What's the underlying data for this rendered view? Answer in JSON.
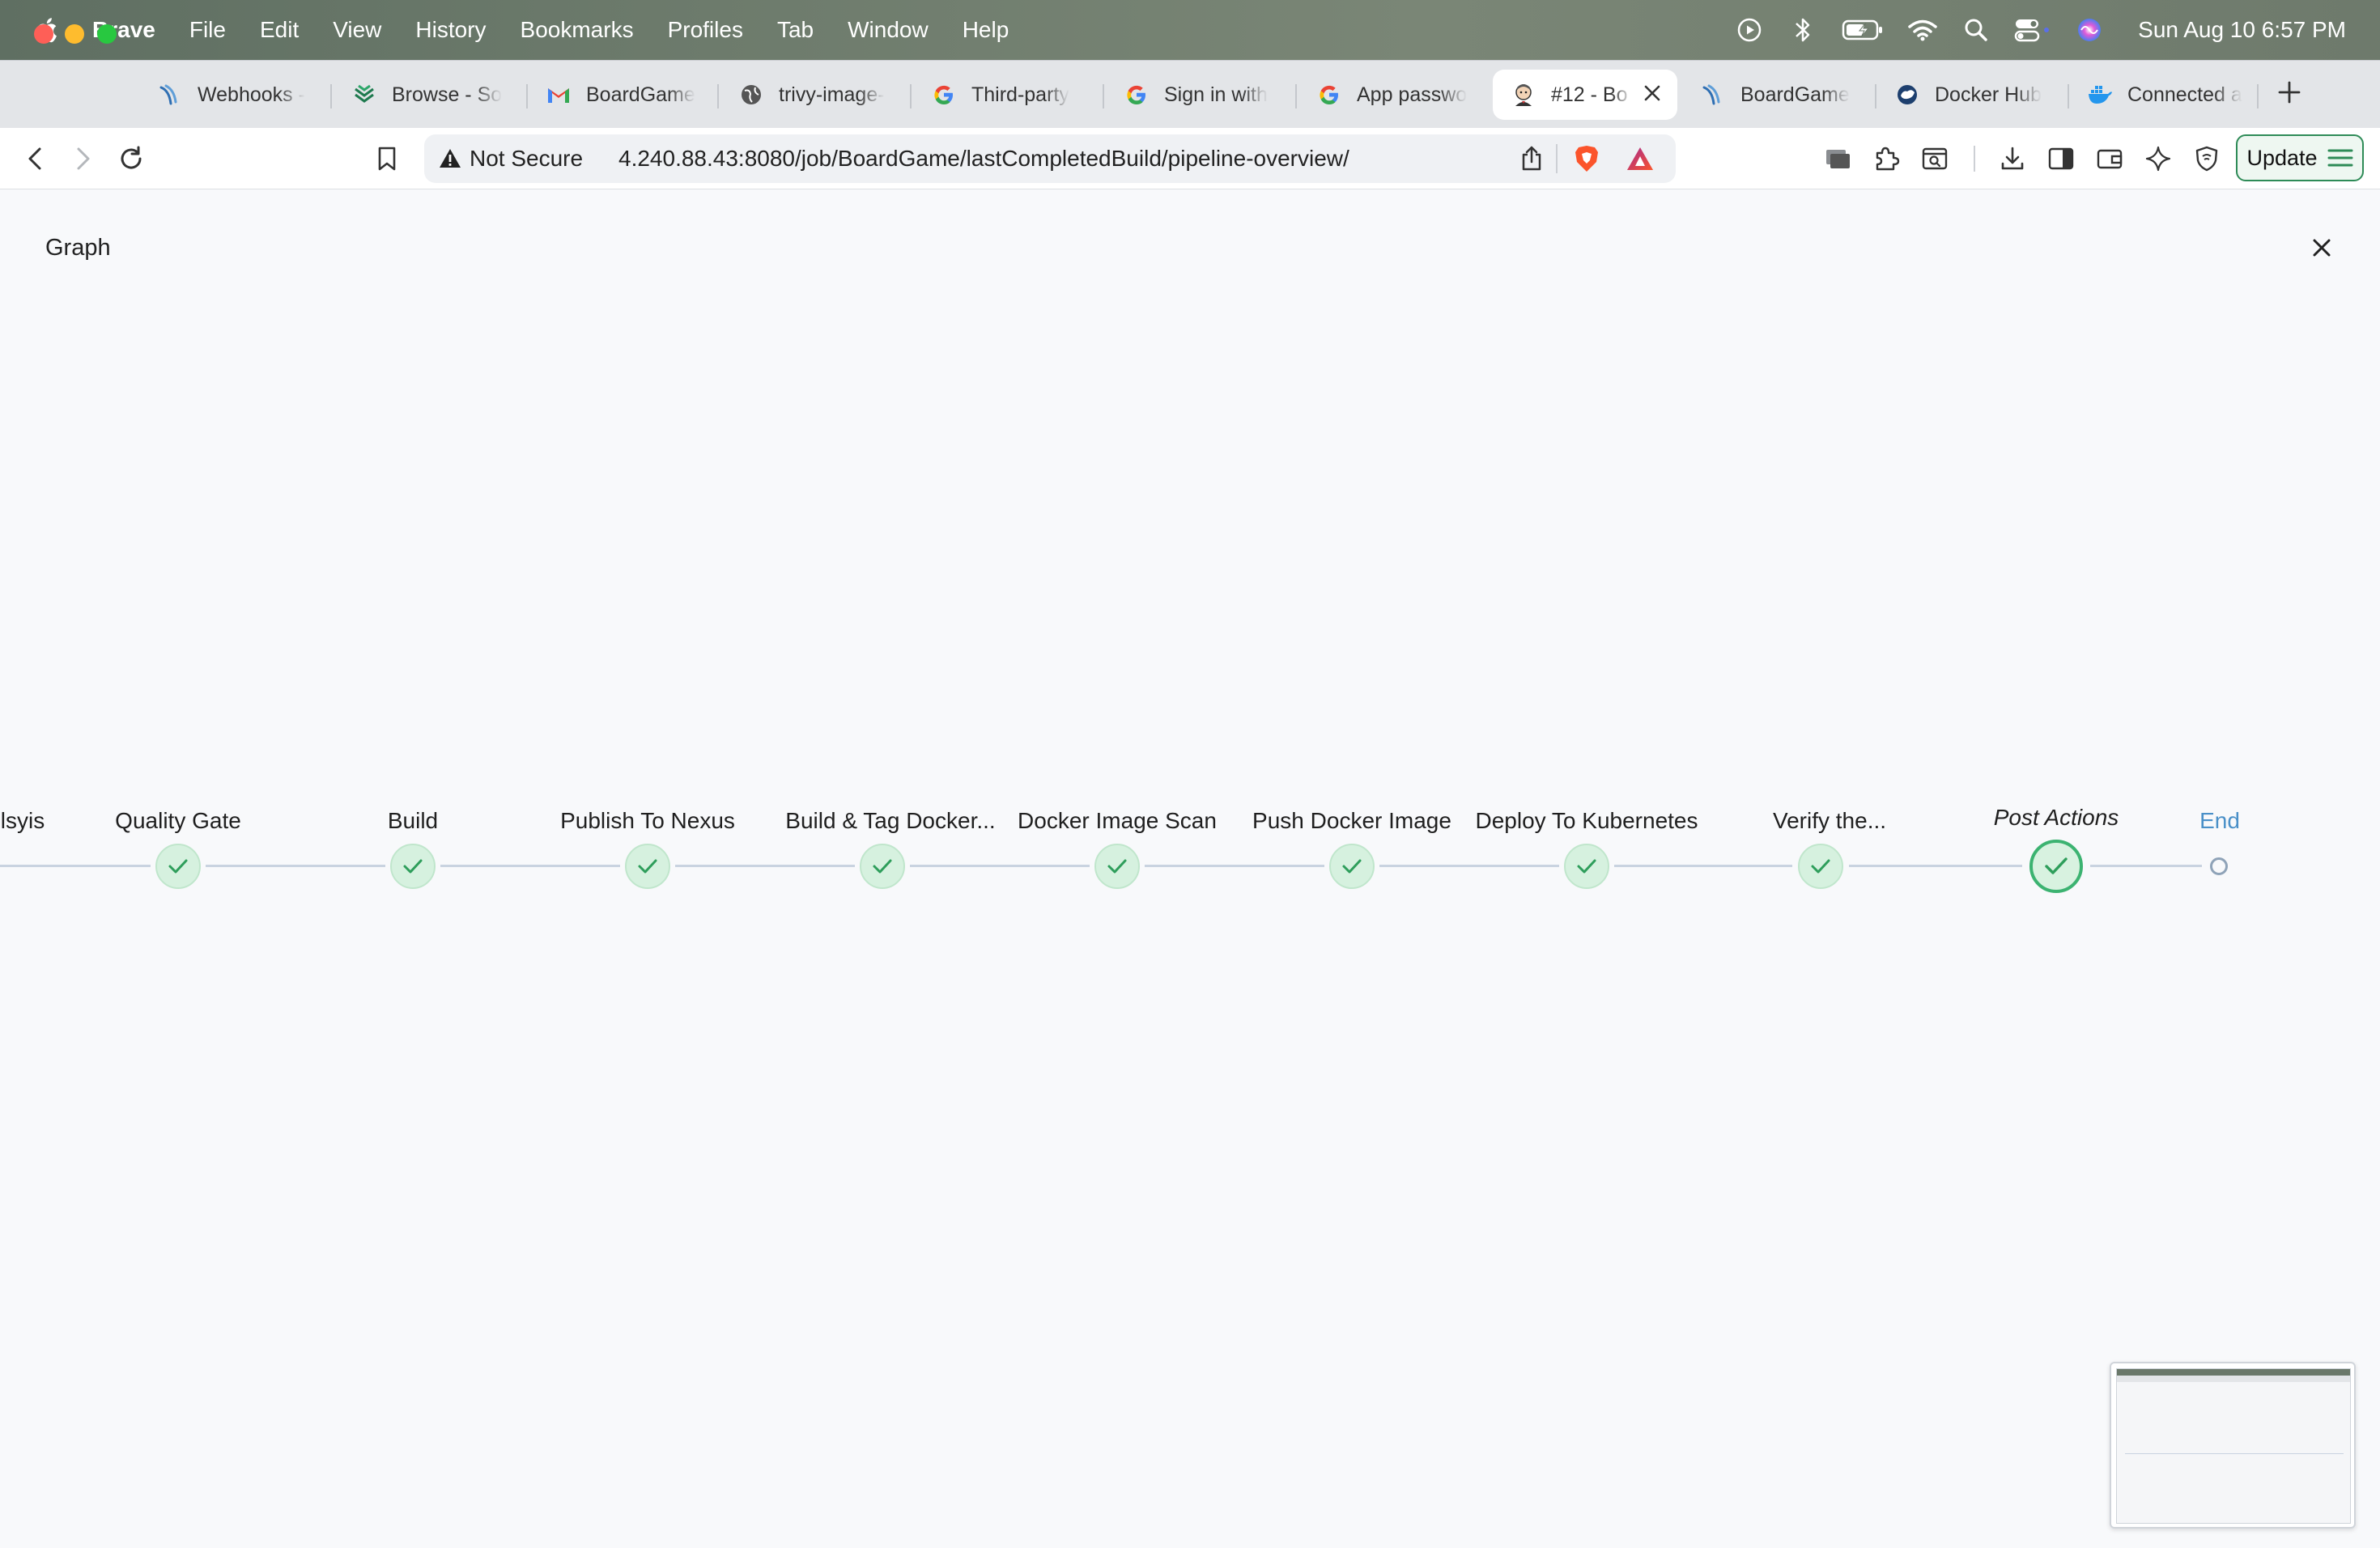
{
  "menubar": {
    "app_name": "Brave",
    "items": [
      "File",
      "Edit",
      "View",
      "History",
      "Bookmarks",
      "Profiles",
      "Tab",
      "Window",
      "Help"
    ],
    "clock": "Sun Aug 10  6:57 PM"
  },
  "tabs": [
    {
      "title": "Webhooks -",
      "icon": "jenkins-icon"
    },
    {
      "title": "Browse - So",
      "icon": "sonatype-icon"
    },
    {
      "title": "BoardGame",
      "icon": "gmail-icon"
    },
    {
      "title": "trivy-image-",
      "icon": "globe-icon"
    },
    {
      "title": "Third-party",
      "icon": "google-icon"
    },
    {
      "title": "Sign in with",
      "icon": "google-icon"
    },
    {
      "title": "App passwo",
      "icon": "google-icon"
    },
    {
      "title": "#12 - Bo",
      "icon": "jenkins-butler-icon",
      "active": true
    },
    {
      "title": "BoardGame",
      "icon": "jenkins-icon"
    },
    {
      "title": "Docker Hub",
      "icon": "docker-hub-icon"
    },
    {
      "title": "Connected a",
      "icon": "docker-icon"
    }
  ],
  "toolbar": {
    "security_label": "Not Secure",
    "url": "4.240.88.43:8080/job/BoardGame/lastCompletedBuild/pipeline-overview/",
    "update_label": "Update"
  },
  "page": {
    "title": "Graph"
  },
  "pipeline": {
    "stages": [
      {
        "name": "lsyis",
        "status": "success"
      },
      {
        "name": "Quality Gate",
        "status": "success"
      },
      {
        "name": "Build",
        "status": "success"
      },
      {
        "name": "Publish To Nexus",
        "status": "success"
      },
      {
        "name": "Build & Tag Docker...",
        "status": "success"
      },
      {
        "name": "Docker Image Scan",
        "status": "success"
      },
      {
        "name": "Push Docker Image",
        "status": "success"
      },
      {
        "name": "Deploy To Kubernetes",
        "status": "success"
      },
      {
        "name": "Verify the...",
        "status": "success"
      },
      {
        "name": "Post Actions",
        "status": "success",
        "selected": true
      },
      {
        "name": "End",
        "status": "end"
      }
    ],
    "success_color": "#3cb371"
  }
}
